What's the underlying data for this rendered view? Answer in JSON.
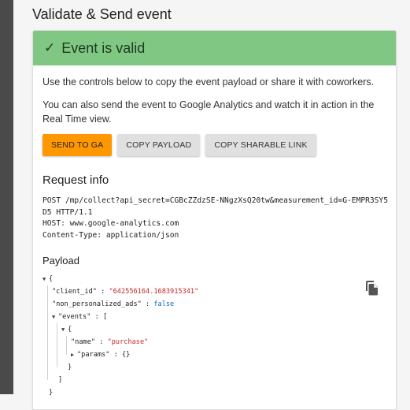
{
  "section_title": "Validate & Send event",
  "banner": {
    "icon": "check-icon",
    "text": "Event is valid"
  },
  "paragraphs": [
    "Use the controls below to copy the event payload or share it with coworkers.",
    "You can also send the event to Google Analytics and watch it in action in the Real Time view."
  ],
  "buttons": {
    "send": "SEND TO GA",
    "copy_payload": "COPY PAYLOAD",
    "copy_link": "COPY SHARABLE LINK"
  },
  "request_info": {
    "title": "Request info",
    "line1": "POST /mp/collect?api_secret=CGBcZZdzSE-NNgzXsQ20tw&measurement_id=G-EMPR3SY5D5 HTTP/1.1",
    "line2": "HOST: www.google-analytics.com",
    "line3": "Content-Type: application/json"
  },
  "payload": {
    "title": "Payload",
    "copy_icon": "copy-icon",
    "open_brace": "{",
    "client_id_key": "\"client_id\"",
    "client_id_value": "\"642556164.1683915341\"",
    "npa_key": "\"non_personalized_ads\"",
    "npa_value": "false",
    "events_key": "\"events\"",
    "open_bracket": "[",
    "event_open": "{",
    "name_key": "\"name\"",
    "name_value": "\"purchase\"",
    "params_key": "\"params\"",
    "params_value": "{}",
    "event_close": "}",
    "close_bracket": "]",
    "close_brace": "}",
    "sep": " : ",
    "comma": ","
  },
  "colors": {
    "banner": "#81c784",
    "send_button": "#ff9800",
    "string_value": "#c62828",
    "bool_value": "#1565c0"
  }
}
